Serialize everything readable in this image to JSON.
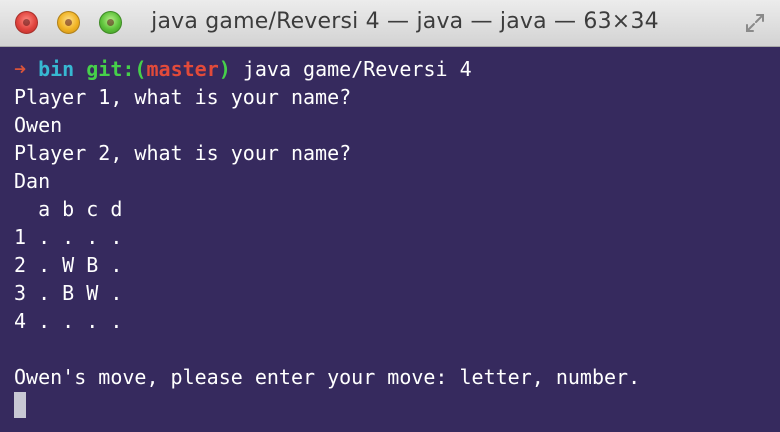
{
  "window": {
    "title": "java game/Reversi 4 — java — java — 63×34"
  },
  "prompt": {
    "arrow": "➜",
    "dir": "bin",
    "git_prefix": "git:(",
    "branch": "master",
    "git_suffix": ")",
    "command": "java game/Reversi 4"
  },
  "output_lines": [
    "Player 1, what is your name?",
    "Owen",
    "Player 2, what is your name?",
    "Dan",
    "  a b c d",
    "1 . . . .",
    "2 . W B .",
    "3 . B W .",
    "4 . . . .",
    "",
    "Owen's move, please enter your move: letter, number."
  ],
  "colors": {
    "background": "#362a5e",
    "prompt_arrow": "#d9533a",
    "prompt_dir": "#37b8d2",
    "prompt_git": "#46d04a",
    "prompt_branch": "#e24a3a"
  }
}
